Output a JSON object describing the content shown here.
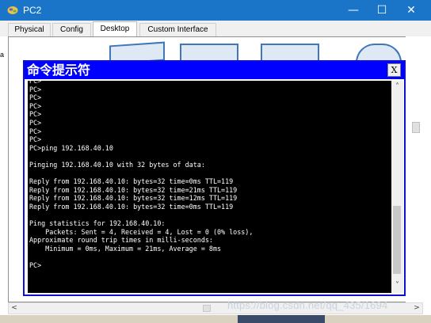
{
  "window": {
    "title": "PC2",
    "controls": {
      "minimize": "—",
      "maximize": "☐",
      "close": "✕"
    }
  },
  "tabs": [
    {
      "label": "Physical",
      "active": false
    },
    {
      "label": "Config",
      "active": false
    },
    {
      "label": "Desktop",
      "active": true
    },
    {
      "label": "Custom Interface",
      "active": false
    }
  ],
  "left_fragment": "a",
  "command_prompt": {
    "title": "命令提示符",
    "close_label": "X",
    "lines": [
      "PC>",
      "PC>",
      "PC>",
      "PC>",
      "PC>",
      "PC>",
      "PC>",
      "PC>",
      "PC>ping 192.168.40.10",
      "",
      "Pinging 192.168.40.10 with 32 bytes of data:",
      "",
      "Reply from 192.168.40.10: bytes=32 time=0ms TTL=119",
      "Reply from 192.168.40.10: bytes=32 time=21ms TTL=119",
      "Reply from 192.168.40.10: bytes=32 time=12ms TTL=119",
      "Reply from 192.168.40.10: bytes=32 time=0ms TTL=119",
      "",
      "Ping statistics for 192.168.40.10:",
      "    Packets: Sent = 4, Received = 4, Lost = 0 (0% loss),",
      "Approximate round trip times in milli-seconds:",
      "    Minimum = 0ms, Maximum = 21ms, Average = 8ms",
      "",
      "PC>"
    ]
  },
  "scroll_arrows": {
    "up": "˄",
    "down": "˅",
    "left": "<",
    "right": ">"
  },
  "watermark": "https://blog.csdn.net/qq_435/1694"
}
